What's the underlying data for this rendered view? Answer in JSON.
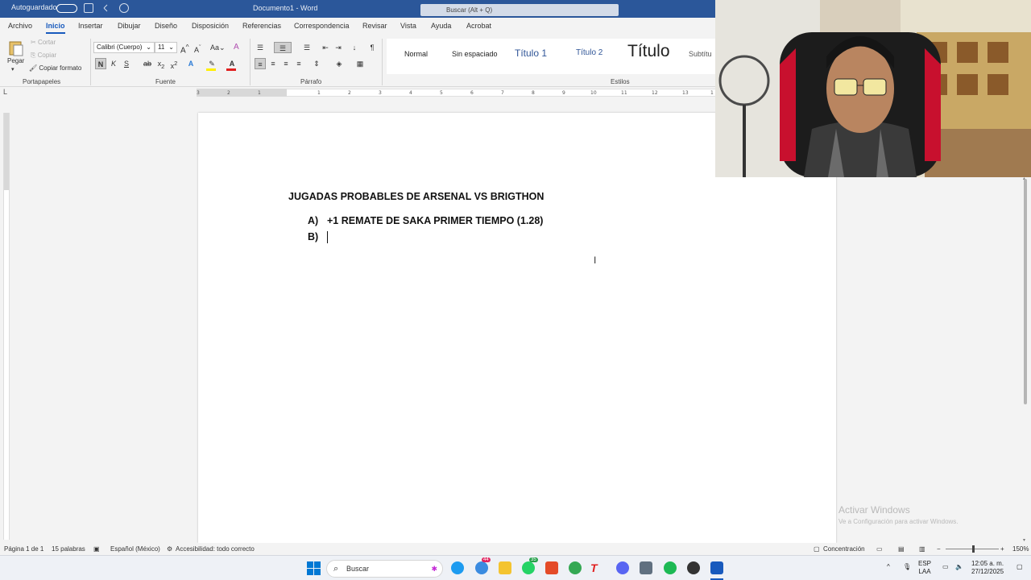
{
  "titlebar": {
    "autosave_label": "Autoguardado",
    "document_name": "Documento1  -  Word",
    "search_placeholder": "Buscar (Alt + Q)"
  },
  "ribbon_tabs": [
    "Archivo",
    "Inicio",
    "Insertar",
    "Dibujar",
    "Diseño",
    "Disposición",
    "Referencias",
    "Correspondencia",
    "Revisar",
    "Vista",
    "Ayuda",
    "Acrobat"
  ],
  "clipboard": {
    "paste": "Pegar",
    "cut": "Cortar",
    "copy": "Copiar",
    "format_painter": "Copiar formato",
    "group": "Portapapeles"
  },
  "font": {
    "family": "Calibri (Cuerpo)",
    "size": "11",
    "group": "Fuente",
    "bold": "N",
    "italic": "K",
    "underline": "S"
  },
  "paragraph": {
    "group": "Párrafo"
  },
  "styles": {
    "group": "Estilos",
    "items": [
      "Normal",
      "Sin espaciado",
      "Título 1",
      "Título 2",
      "Título",
      "Subtítu"
    ]
  },
  "document": {
    "title": "JUGADAS PROBABLES DE ARSENAL VS BRIGTHON",
    "list": [
      {
        "marker": "A)",
        "text": "+1 REMATE DE SAKA PRIMER TIEMPO (1.28)"
      },
      {
        "marker": "B)",
        "text": ""
      }
    ]
  },
  "activation": {
    "heading": "Activar Windows",
    "sub": "Ve a Configuración para activar Windows."
  },
  "statusbar": {
    "page": "Página 1 de 1",
    "words": "15 palabras",
    "language": "Español (México)",
    "accessibility": "Accesibilidad: todo correcto",
    "focus": "Concentración",
    "zoom": "150%"
  },
  "taskbar": {
    "search": "Buscar",
    "badge_edge": "44",
    "badge_whatsapp": "35",
    "lang": "ESP",
    "lang2": "LAA",
    "time": "12:05 a. m.",
    "date": "27/12/2025"
  },
  "colors": {
    "titlebar": "#2b579a",
    "accent": "#185abd"
  }
}
